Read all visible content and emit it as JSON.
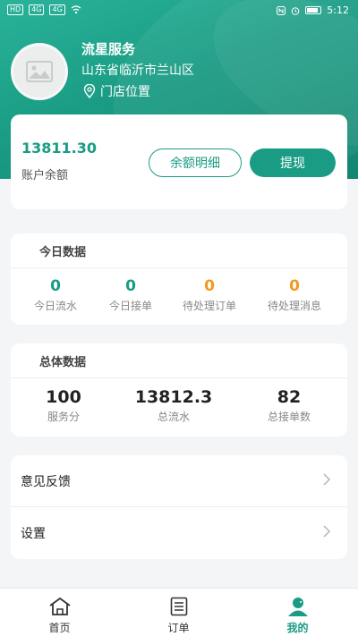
{
  "statusbar": {
    "left_chips": [
      "HD",
      "4G",
      "4G"
    ],
    "time": "5:12"
  },
  "shop": {
    "name": "流星服务",
    "address": "山东省临沂市兰山区",
    "location_label": "门店位置"
  },
  "balance": {
    "amount": "13811.30",
    "label": "账户余额",
    "detail_button": "余额明细",
    "withdraw_button": "提现"
  },
  "today": {
    "title": "今日数据",
    "stats": [
      {
        "value": "0",
        "label": "今日流水"
      },
      {
        "value": "0",
        "label": "今日接单"
      },
      {
        "value": "0",
        "label": "待处理订单"
      },
      {
        "value": "0",
        "label": "待处理消息"
      }
    ]
  },
  "total": {
    "title": "总体数据",
    "stats": [
      {
        "value": "100",
        "label": "服务分"
      },
      {
        "value": "13812.3",
        "label": "总流水"
      },
      {
        "value": "82",
        "label": "总接单数"
      }
    ]
  },
  "menu": {
    "feedback": "意见反馈",
    "settings": "设置"
  },
  "tabs": [
    {
      "label": "首页",
      "icon": "home-icon"
    },
    {
      "label": "订单",
      "icon": "orders-icon"
    },
    {
      "label": "我的",
      "icon": "profile-icon"
    }
  ],
  "colors": {
    "accent": "#1a9c84",
    "warning": "#f39a1c",
    "background": "#f4f5f7"
  }
}
